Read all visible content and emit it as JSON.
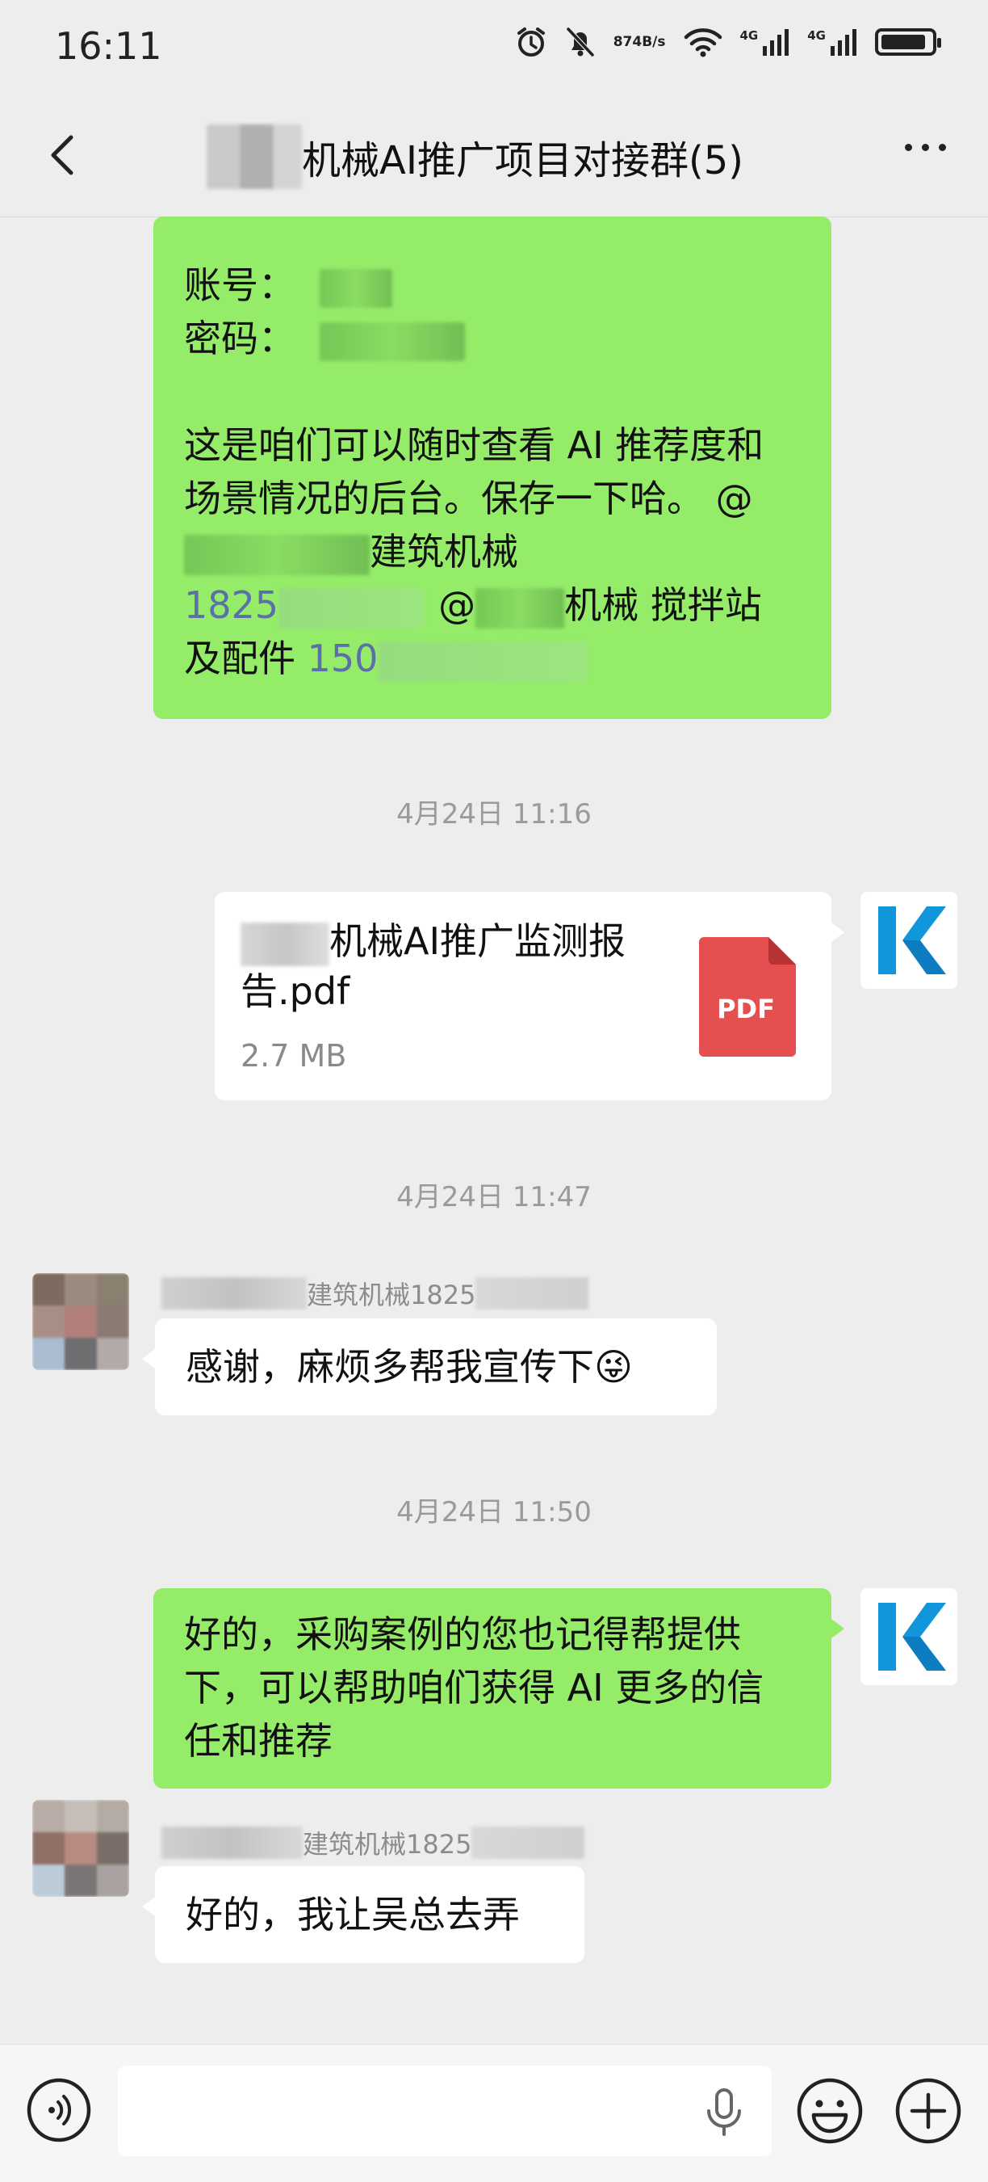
{
  "status_bar": {
    "time": "16:11",
    "net_speed_value": "874",
    "net_speed_unit": "B/s",
    "signal1_label": "4G",
    "signal2_label": "4G",
    "battery_level": 0.9
  },
  "header": {
    "title": "机械AI推广项目对接群(5)"
  },
  "messages": {
    "m1": {
      "account_label": "账号：",
      "password_label": "密码：",
      "body_line1": "这是咱们可以随时查看 AI 推荐度和",
      "body_line2": "场景情况的后台。保存一下哈。 @",
      "body_line3_suffix": "建筑机械",
      "body_line4_prefix": "1825",
      "body_line4_at": "@",
      "body_line4_suffix": "机械 搅拌站",
      "body_line5_prefix": "及配件 ",
      "body_line5_num": "150"
    },
    "ts1": "4月24日 11:16",
    "file": {
      "name_line1": "机械AI推广监测报",
      "name_line2": "告.pdf",
      "size": "2.7 MB",
      "icon_label": "PDF"
    },
    "ts2": "4月24日 11:47",
    "m2": {
      "sender": "建筑机械1825",
      "text": "感谢，麻烦多帮我宣传下😜"
    },
    "ts3": "4月24日 11:50",
    "m3": {
      "line1": "好的，采购案例的您也记得帮提供",
      "line2": "下，可以帮助咱们获得 AI 更多的信",
      "line3": "任和推荐"
    },
    "m4": {
      "sender": "建筑机械1825",
      "text": "好的，我让吴总去弄"
    }
  },
  "colors": {
    "own_bubble": "#95ec69",
    "other_bubble": "#ffffff",
    "background": "#ededed",
    "pdf_red": "#e64f4f",
    "k_logo_blue": "#1296db"
  }
}
